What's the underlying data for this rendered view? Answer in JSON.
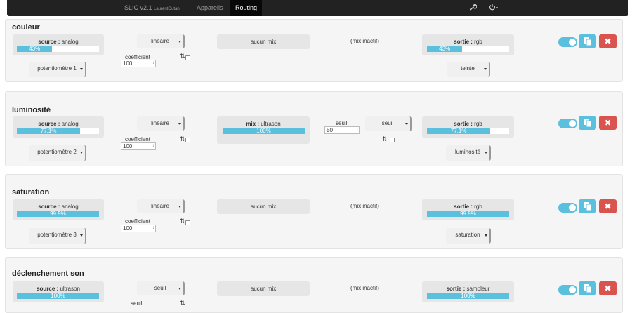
{
  "nav": {
    "brand": "SLIC v2.1",
    "user": "LaurentOutan",
    "items": [
      "Appareils",
      "Routing"
    ],
    "active": "Routing"
  },
  "icons": {
    "settings": "wrench-icon",
    "power": "power-icon",
    "copy": "copy-icon",
    "delete": "close-icon"
  },
  "colors": {
    "accent": "#5bc0de",
    "danger": "#d9534f",
    "navbar": "#222222"
  },
  "routes": [
    {
      "title": "couleur",
      "source": {
        "label": "source :",
        "type": "analog",
        "percent": 0.43,
        "text": "43%"
      },
      "input": "potentiomètre 1",
      "mode": "linéaire",
      "coef_label": "coefficient",
      "coef": "100",
      "mix": {
        "text": "aucun mix"
      },
      "mix_status": "(mix inactif)",
      "sortie": {
        "label": "sortie :",
        "type": "rgb",
        "percent": 0.43,
        "text": "43%"
      },
      "output": "teinte",
      "enabled": true
    },
    {
      "title": "luminosité",
      "source": {
        "label": "source :",
        "type": "analog",
        "percent": 0.771,
        "text": "77.1%"
      },
      "input": "potentiomètre 2",
      "mode": "linéaire",
      "coef_label": "coefficient",
      "coef": "100",
      "mix": {
        "label": "mix :",
        "type": "ultrason",
        "percent": 1.0,
        "text": "100%"
      },
      "seuil_label": "seuil",
      "seuil": "50",
      "seuil_mode": "seuil",
      "sortie": {
        "label": "sortie :",
        "type": "rgb",
        "percent": 0.771,
        "text": "77.1%"
      },
      "output": "luminosité",
      "enabled": true
    },
    {
      "title": "saturation",
      "source": {
        "label": "source :",
        "type": "analog",
        "percent": 0.999,
        "text": "99.9%"
      },
      "input": "potentiomètre 3",
      "mode": "linéaire",
      "coef_label": "coefficient",
      "coef": "100",
      "mix": {
        "text": "aucun mix"
      },
      "mix_status": "(mix inactif)",
      "sortie": {
        "label": "sortie :",
        "type": "rgb",
        "percent": 0.999,
        "text": "99.9%"
      },
      "output": "saturation",
      "enabled": true
    },
    {
      "title": "déclenchement son",
      "source": {
        "label": "source :",
        "type": "ultrason",
        "percent": 1.0,
        "text": "100%"
      },
      "mode": "seuil",
      "coef_label": "seuil",
      "mix": {
        "text": "aucun mix"
      },
      "mix_status": "(mix inactif)",
      "sortie": {
        "label": "sortie :",
        "type": "sampleur",
        "percent": 1.0,
        "text": "100%"
      },
      "enabled": true
    }
  ]
}
